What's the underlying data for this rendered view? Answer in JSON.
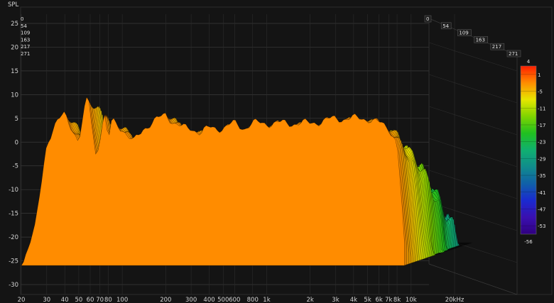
{
  "chart_data": {
    "type": "waterfall",
    "y_axis_title": "SPL",
    "x_unit": "Hz",
    "y_ticks": [
      25,
      20,
      15,
      10,
      5,
      0,
      -5,
      -10,
      -15,
      -20,
      -25,
      -30
    ],
    "ylim": [
      -30,
      25
    ],
    "x_ticks": [
      {
        "f": 20,
        "label": "20"
      },
      {
        "f": 30,
        "label": "30"
      },
      {
        "f": 40,
        "label": "40"
      },
      {
        "f": 50,
        "label": "50"
      },
      {
        "f": 60,
        "label": "60"
      },
      {
        "f": 70,
        "label": "70"
      },
      {
        "f": 80,
        "label": "80"
      },
      {
        "f": 100,
        "label": "100"
      },
      {
        "f": 200,
        "label": "200"
      },
      {
        "f": 300,
        "label": "300"
      },
      {
        "f": 400,
        "label": "400"
      },
      {
        "f": 500,
        "label": "500"
      },
      {
        "f": 600,
        "label": "600"
      },
      {
        "f": 800,
        "label": "800"
      },
      {
        "f": 1000,
        "label": "1k"
      },
      {
        "f": 2000,
        "label": "2k"
      },
      {
        "f": 3000,
        "label": "3k"
      },
      {
        "f": 4000,
        "label": "4k"
      },
      {
        "f": 5000,
        "label": "5k"
      },
      {
        "f": 6000,
        "label": "6k"
      },
      {
        "f": 7000,
        "label": "7k"
      },
      {
        "f": 8000,
        "label": "8k"
      },
      {
        "f": 10000,
        "label": "10k"
      },
      {
        "f": 20000,
        "label": "20kHz"
      }
    ],
    "xlim": [
      20,
      20000
    ],
    "time_ticks": [
      "0",
      "54",
      "109",
      "163",
      "217",
      "271"
    ],
    "colorbar": {
      "max_label": "4",
      "labels": [
        "1",
        "-5",
        "-11",
        "-17",
        "-23",
        "-29",
        "-35",
        "-41",
        "-47",
        "-53"
      ],
      "min_label": "-56",
      "range": [
        -56,
        4
      ],
      "colors": [
        "#ff1e00",
        "#ff8c00",
        "#e6e600",
        "#7fd400",
        "#20c020",
        "#10b070",
        "#108c8c",
        "#1060a8",
        "#1a2ad0",
        "#3a10b0",
        "#300080"
      ]
    },
    "slice_count": 60,
    "response_points": [
      [
        20,
        -26
      ],
      [
        25,
        -18
      ],
      [
        30,
        0
      ],
      [
        35,
        4
      ],
      [
        40,
        6
      ],
      [
        45,
        3
      ],
      [
        50,
        0
      ],
      [
        55,
        7
      ],
      [
        58,
        10
      ],
      [
        62,
        3
      ],
      [
        66,
        -3
      ],
      [
        70,
        1
      ],
      [
        75,
        6
      ],
      [
        80,
        0
      ],
      [
        85,
        5
      ],
      [
        90,
        4
      ],
      [
        100,
        3
      ],
      [
        110,
        1
      ],
      [
        120,
        0
      ],
      [
        140,
        3
      ],
      [
        160,
        4
      ],
      [
        180,
        5
      ],
      [
        200,
        6
      ],
      [
        230,
        4
      ],
      [
        260,
        3
      ],
      [
        300,
        3
      ],
      [
        350,
        2
      ],
      [
        400,
        3
      ],
      [
        500,
        3
      ],
      [
        600,
        4
      ],
      [
        700,
        3
      ],
      [
        800,
        4
      ],
      [
        1000,
        4
      ],
      [
        1500,
        4
      ],
      [
        2000,
        4
      ],
      [
        3000,
        5
      ],
      [
        4000,
        5
      ],
      [
        5000,
        5
      ],
      [
        6000,
        4
      ],
      [
        7000,
        3
      ],
      [
        8000,
        0
      ],
      [
        8500,
        -10
      ],
      [
        9000,
        -22
      ]
    ]
  }
}
